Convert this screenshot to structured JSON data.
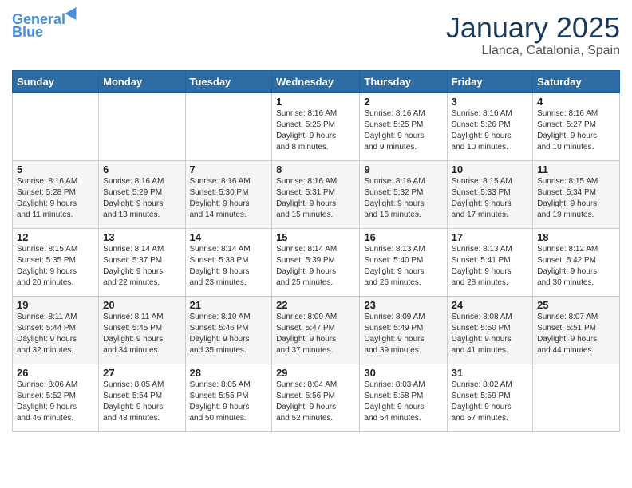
{
  "header": {
    "logo_line1": "General",
    "logo_line2": "Blue",
    "month": "January 2025",
    "location": "Llanca, Catalonia, Spain"
  },
  "weekdays": [
    "Sunday",
    "Monday",
    "Tuesday",
    "Wednesday",
    "Thursday",
    "Friday",
    "Saturday"
  ],
  "weeks": [
    [
      {
        "day": "",
        "info": ""
      },
      {
        "day": "",
        "info": ""
      },
      {
        "day": "",
        "info": ""
      },
      {
        "day": "1",
        "info": "Sunrise: 8:16 AM\nSunset: 5:25 PM\nDaylight: 9 hours\nand 8 minutes."
      },
      {
        "day": "2",
        "info": "Sunrise: 8:16 AM\nSunset: 5:25 PM\nDaylight: 9 hours\nand 9 minutes."
      },
      {
        "day": "3",
        "info": "Sunrise: 8:16 AM\nSunset: 5:26 PM\nDaylight: 9 hours\nand 10 minutes."
      },
      {
        "day": "4",
        "info": "Sunrise: 8:16 AM\nSunset: 5:27 PM\nDaylight: 9 hours\nand 10 minutes."
      }
    ],
    [
      {
        "day": "5",
        "info": "Sunrise: 8:16 AM\nSunset: 5:28 PM\nDaylight: 9 hours\nand 11 minutes."
      },
      {
        "day": "6",
        "info": "Sunrise: 8:16 AM\nSunset: 5:29 PM\nDaylight: 9 hours\nand 13 minutes."
      },
      {
        "day": "7",
        "info": "Sunrise: 8:16 AM\nSunset: 5:30 PM\nDaylight: 9 hours\nand 14 minutes."
      },
      {
        "day": "8",
        "info": "Sunrise: 8:16 AM\nSunset: 5:31 PM\nDaylight: 9 hours\nand 15 minutes."
      },
      {
        "day": "9",
        "info": "Sunrise: 8:16 AM\nSunset: 5:32 PM\nDaylight: 9 hours\nand 16 minutes."
      },
      {
        "day": "10",
        "info": "Sunrise: 8:15 AM\nSunset: 5:33 PM\nDaylight: 9 hours\nand 17 minutes."
      },
      {
        "day": "11",
        "info": "Sunrise: 8:15 AM\nSunset: 5:34 PM\nDaylight: 9 hours\nand 19 minutes."
      }
    ],
    [
      {
        "day": "12",
        "info": "Sunrise: 8:15 AM\nSunset: 5:35 PM\nDaylight: 9 hours\nand 20 minutes."
      },
      {
        "day": "13",
        "info": "Sunrise: 8:14 AM\nSunset: 5:37 PM\nDaylight: 9 hours\nand 22 minutes."
      },
      {
        "day": "14",
        "info": "Sunrise: 8:14 AM\nSunset: 5:38 PM\nDaylight: 9 hours\nand 23 minutes."
      },
      {
        "day": "15",
        "info": "Sunrise: 8:14 AM\nSunset: 5:39 PM\nDaylight: 9 hours\nand 25 minutes."
      },
      {
        "day": "16",
        "info": "Sunrise: 8:13 AM\nSunset: 5:40 PM\nDaylight: 9 hours\nand 26 minutes."
      },
      {
        "day": "17",
        "info": "Sunrise: 8:13 AM\nSunset: 5:41 PM\nDaylight: 9 hours\nand 28 minutes."
      },
      {
        "day": "18",
        "info": "Sunrise: 8:12 AM\nSunset: 5:42 PM\nDaylight: 9 hours\nand 30 minutes."
      }
    ],
    [
      {
        "day": "19",
        "info": "Sunrise: 8:11 AM\nSunset: 5:44 PM\nDaylight: 9 hours\nand 32 minutes."
      },
      {
        "day": "20",
        "info": "Sunrise: 8:11 AM\nSunset: 5:45 PM\nDaylight: 9 hours\nand 34 minutes."
      },
      {
        "day": "21",
        "info": "Sunrise: 8:10 AM\nSunset: 5:46 PM\nDaylight: 9 hours\nand 35 minutes."
      },
      {
        "day": "22",
        "info": "Sunrise: 8:09 AM\nSunset: 5:47 PM\nDaylight: 9 hours\nand 37 minutes."
      },
      {
        "day": "23",
        "info": "Sunrise: 8:09 AM\nSunset: 5:49 PM\nDaylight: 9 hours\nand 39 minutes."
      },
      {
        "day": "24",
        "info": "Sunrise: 8:08 AM\nSunset: 5:50 PM\nDaylight: 9 hours\nand 41 minutes."
      },
      {
        "day": "25",
        "info": "Sunrise: 8:07 AM\nSunset: 5:51 PM\nDaylight: 9 hours\nand 44 minutes."
      }
    ],
    [
      {
        "day": "26",
        "info": "Sunrise: 8:06 AM\nSunset: 5:52 PM\nDaylight: 9 hours\nand 46 minutes."
      },
      {
        "day": "27",
        "info": "Sunrise: 8:05 AM\nSunset: 5:54 PM\nDaylight: 9 hours\nand 48 minutes."
      },
      {
        "day": "28",
        "info": "Sunrise: 8:05 AM\nSunset: 5:55 PM\nDaylight: 9 hours\nand 50 minutes."
      },
      {
        "day": "29",
        "info": "Sunrise: 8:04 AM\nSunset: 5:56 PM\nDaylight: 9 hours\nand 52 minutes."
      },
      {
        "day": "30",
        "info": "Sunrise: 8:03 AM\nSunset: 5:58 PM\nDaylight: 9 hours\nand 54 minutes."
      },
      {
        "day": "31",
        "info": "Sunrise: 8:02 AM\nSunset: 5:59 PM\nDaylight: 9 hours\nand 57 minutes."
      },
      {
        "day": "",
        "info": ""
      }
    ]
  ]
}
